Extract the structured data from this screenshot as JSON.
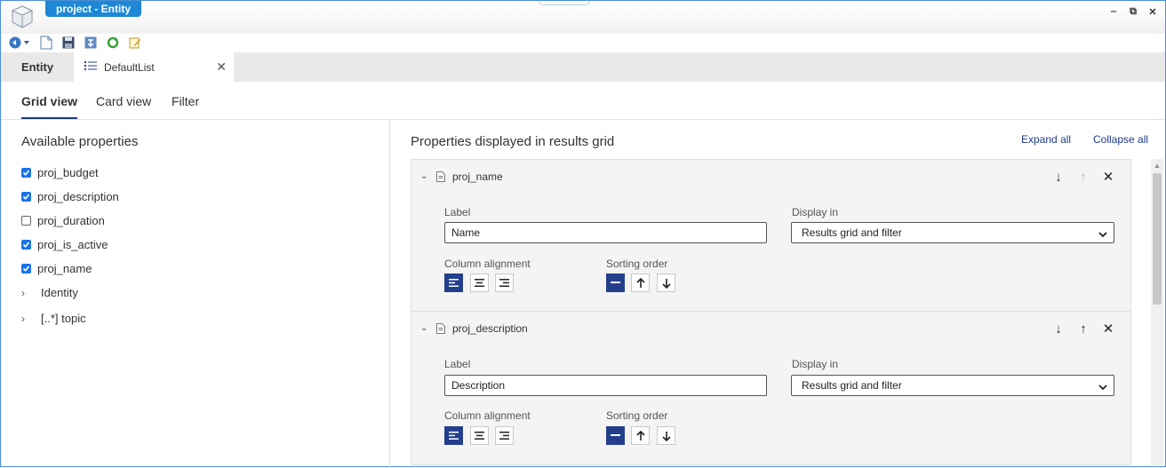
{
  "window": {
    "title": "project - Entity"
  },
  "document_tabs": [
    {
      "label": "Entity"
    },
    {
      "label": "DefaultList"
    }
  ],
  "view_tabs": [
    {
      "label": "Grid view",
      "active": true
    },
    {
      "label": "Card view",
      "active": false
    },
    {
      "label": "Filter",
      "active": false
    }
  ],
  "available": {
    "title": "Available properties",
    "properties": [
      {
        "label": "proj_budget",
        "checked": true
      },
      {
        "label": "proj_description",
        "checked": true
      },
      {
        "label": "proj_duration",
        "checked": false
      },
      {
        "label": "proj_is_active",
        "checked": true
      },
      {
        "label": "proj_name",
        "checked": true
      }
    ],
    "groups": [
      {
        "label": "Identity"
      },
      {
        "label": "[..*] topic"
      }
    ]
  },
  "displayed": {
    "title": "Properties displayed in results grid",
    "expand_all": "Expand all",
    "collapse_all": "Collapse all",
    "cards": [
      {
        "name": "proj_name",
        "label_caption": "Label",
        "label_value": "Name",
        "display_caption": "Display in",
        "display_value": "Results grid and filter",
        "alignment_caption": "Column alignment",
        "sorting_caption": "Sorting order",
        "alignment": "left",
        "sorting": "none",
        "move_up_enabled": false
      },
      {
        "name": "proj_description",
        "label_caption": "Label",
        "label_value": "Description",
        "display_caption": "Display in",
        "display_value": "Results grid and filter",
        "alignment_caption": "Column alignment",
        "sorting_caption": "Sorting order",
        "alignment": "left",
        "sorting": "none",
        "move_up_enabled": true
      }
    ]
  },
  "colors": {
    "accent": "#233f8c",
    "title_pill": "#1e88d6",
    "checkbox": "#1a73e8",
    "link": "#1e3a8a"
  }
}
